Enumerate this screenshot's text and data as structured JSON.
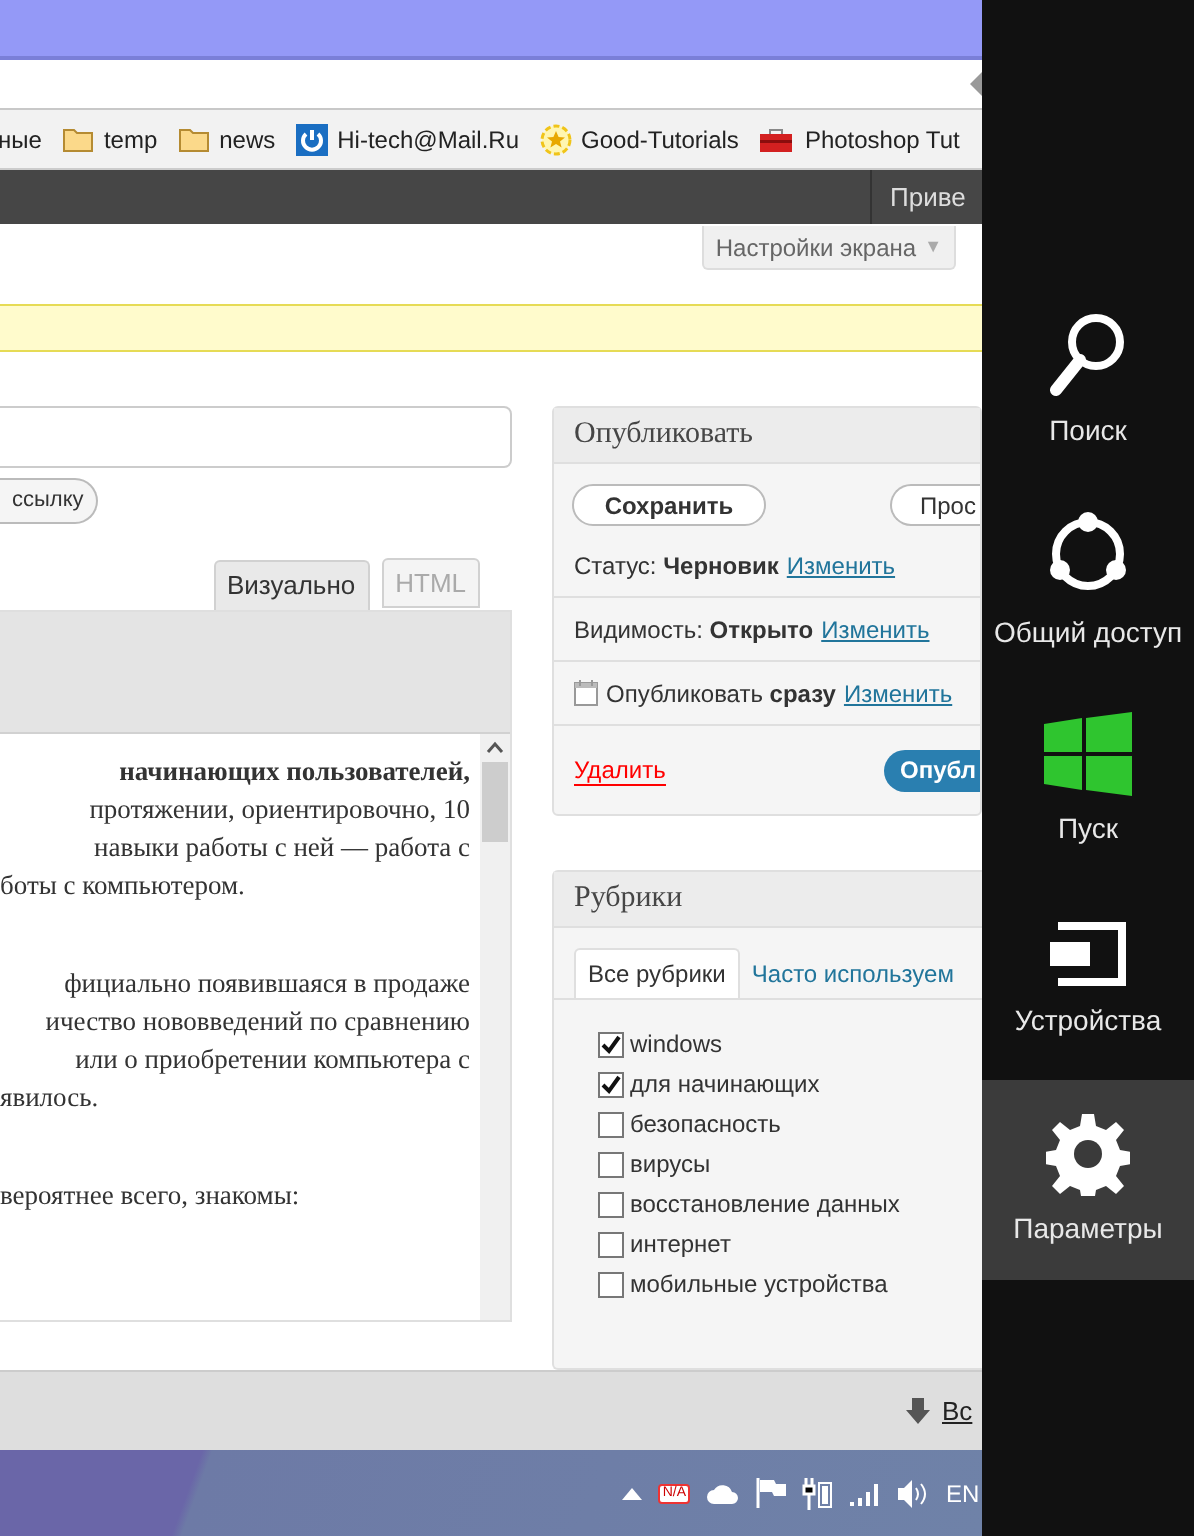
{
  "bookmarks": [
    {
      "label": "ные",
      "kind": "plain"
    },
    {
      "label": "temp",
      "kind": "folder"
    },
    {
      "label": "news",
      "kind": "folder"
    },
    {
      "label": "Hi-tech@Mail.Ru",
      "kind": "power"
    },
    {
      "label": "Good-Tutorials",
      "kind": "star"
    },
    {
      "label": "Photoshop Tut",
      "kind": "toolbox"
    }
  ],
  "admin_bar": {
    "greeting": "Приве"
  },
  "screen_options": {
    "label": "Настройки экрана",
    "caret": "▼"
  },
  "editor": {
    "shortlink_button": "ссылку",
    "tabs": [
      {
        "label": "Визуально",
        "selected": true
      },
      {
        "label": "HTML",
        "selected": false
      }
    ],
    "paragraphs": [
      {
        "lines": [
          {
            "text": "начинающих пользователей,",
            "bold": true
          },
          {
            "text": "протяжении, ориентировочно, 10",
            "bold": false
          },
          {
            "text": "навыки работы с ней — работа с",
            "bold": false
          },
          {
            "text": "боты с компьютером.",
            "bold": false
          }
        ]
      },
      {
        "lines": [
          {
            "text": "фициально появившаяся в продаже",
            "bold": false
          },
          {
            "text": "ичество нововведений по сравнению",
            "bold": false
          },
          {
            "text": "или о приобретении компьютера с",
            "bold": false
          },
          {
            "text": "явилось.",
            "bold": false
          }
        ]
      },
      {
        "lines": [
          {
            "text": "вероятнее всего, знакомы:",
            "bold": false
          }
        ]
      }
    ]
  },
  "publish": {
    "title": "Опубликовать",
    "save_button": "Сохранить",
    "preview_button": "Прос",
    "rows": [
      {
        "kind": "status",
        "label": "Статус:",
        "value": "Черновик",
        "link": "Изменить"
      },
      {
        "kind": "visibility",
        "label": "Видимость:",
        "value": "Открыто",
        "link": "Изменить"
      },
      {
        "kind": "schedule",
        "label": "Опубликовать",
        "value": "сразу",
        "link": "Изменить"
      }
    ],
    "delete_link": "Удалить",
    "publish_button": "Опубл"
  },
  "categories": {
    "title": "Рубрики",
    "tabs": [
      {
        "label": "Все рубрики",
        "selected": true
      },
      {
        "label": "Часто используем",
        "selected": false
      }
    ],
    "items": [
      {
        "label": "windows",
        "checked": true
      },
      {
        "label": "для начинающих",
        "checked": true
      },
      {
        "label": "безопасность",
        "checked": false
      },
      {
        "label": "вирусы",
        "checked": false
      },
      {
        "label": "восстановление данных",
        "checked": false
      },
      {
        "label": "интернет",
        "checked": false
      },
      {
        "label": "мобильные устройства",
        "checked": false
      }
    ]
  },
  "downloads": {
    "link": "Вс"
  },
  "taskbar": {
    "na_badge": "N/A",
    "language": "EN"
  },
  "charms": [
    {
      "label": "Поиск",
      "kind": "search",
      "selected": false
    },
    {
      "label": "Общий доступ",
      "kind": "share",
      "selected": false
    },
    {
      "label": "Пуск",
      "kind": "start",
      "selected": false
    },
    {
      "label": "Устройства",
      "kind": "devices",
      "selected": false
    },
    {
      "label": "Параметры",
      "kind": "settings",
      "selected": true
    }
  ]
}
